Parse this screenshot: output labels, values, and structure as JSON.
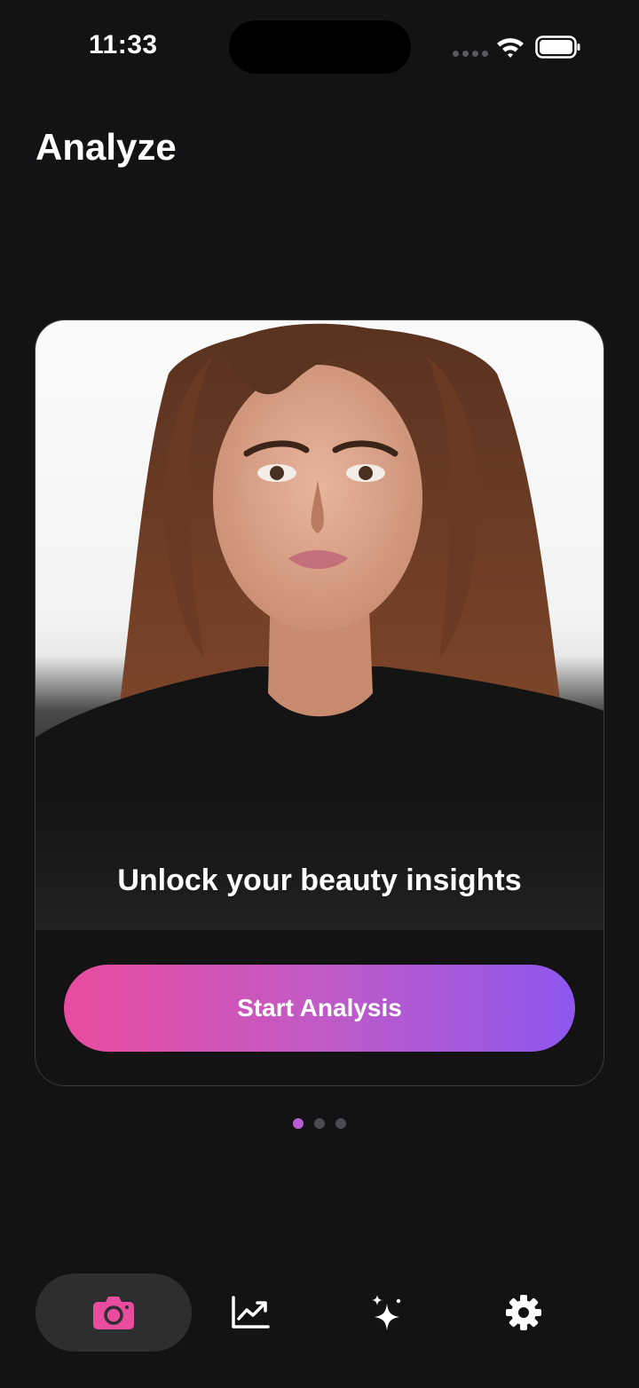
{
  "status_bar": {
    "time": "11:33"
  },
  "header": {
    "title": "Analyze"
  },
  "card": {
    "caption": "Unlock your beauty insights",
    "button_label": "Start Analysis"
  },
  "pager": {
    "count": 3,
    "active_index": 0
  },
  "tab_bar": {
    "tabs": [
      {
        "icon": "camera-icon",
        "active": true
      },
      {
        "icon": "trend-chart-icon",
        "active": false
      },
      {
        "icon": "sparkles-icon",
        "active": false
      },
      {
        "icon": "gear-icon",
        "active": false
      }
    ]
  },
  "colors": {
    "background": "#131315",
    "accent_pink": "#e94b9f",
    "accent_purple": "#8e57ee",
    "pager_active": "#b75cd3",
    "tab_active_bg": "#2e2e31"
  }
}
